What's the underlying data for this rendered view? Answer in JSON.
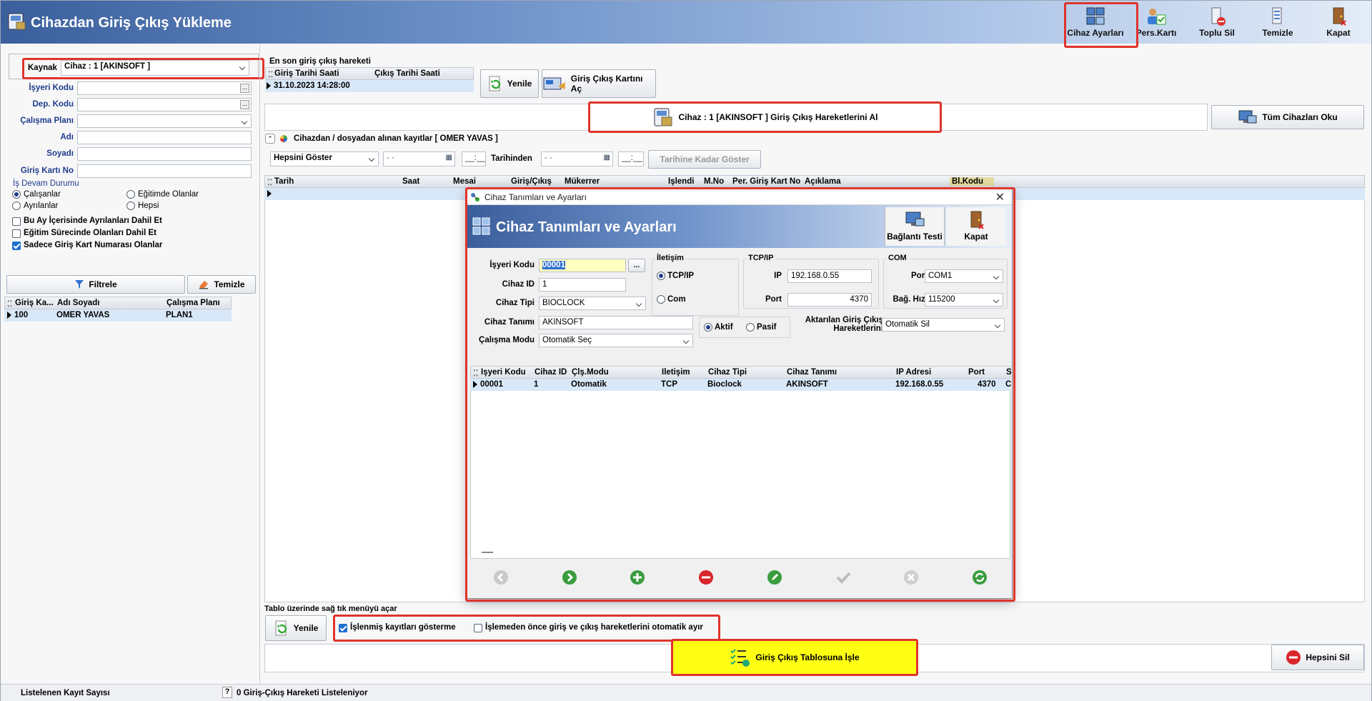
{
  "window": {
    "title": "Cihazdan Giriş Çıkış Yükleme"
  },
  "toolbar": {
    "device_settings": "Cihaz Ayarları",
    "pers_card": "Pers.Kartı",
    "bulk_delete": "Toplu Sil",
    "clear": "Temizle",
    "close": "Kapat"
  },
  "filters": {
    "source_label": "Kaynak",
    "source_value": "Cihaz : 1 [AKINSOFT ]",
    "workplace_label": "İşyeri Kodu",
    "dept_label": "Dep. Kodu",
    "plan_label": "Çalışma Planı",
    "name_label": "Adı",
    "surname_label": "Soyadı",
    "card_label": "Giriş Kartı No",
    "status_group": "İş Devam Durumu",
    "opt_working": "Çalışanlar",
    "opt_training": "Eğitimde Olanlar",
    "opt_left": "Ayrılanlar",
    "opt_all": "Hepsi",
    "chk_month": "Bu Ay İçerisinde Ayrılanları Dahil Et",
    "chk_training": "Eğitim Sürecinde Olanları Dahil Et",
    "chk_only_card": "Sadece Giriş Kart Numarası Olanlar",
    "filter_btn": "Filtrele",
    "clear_btn": "Temizle"
  },
  "people": {
    "headers": [
      "Giriş Ka...",
      "Adı Soyadı",
      "Çalışma Planı"
    ],
    "rows": [
      {
        "card": "100",
        "name": "OMER YAVAS",
        "plan": "PLAN1"
      }
    ]
  },
  "last": {
    "title": "En son giriş çıkış hareketi",
    "h_in": "Giriş Tarihi Saati",
    "h_out": "Çıkış Tarihi Saati",
    "in_value": "31.10.2023 14:28:00",
    "refresh": "Yenile",
    "open_card": "Giriş Çıkış Kartını Aç"
  },
  "fetch": {
    "get_btn": "Cihaz : 1 [AKINSOFT ] Giriş Çıkış Hareketlerini Al",
    "read_all": "Tüm Cihazları Oku"
  },
  "records": {
    "caption": "Cihazdan / dosyadan alınan kayıtlar [ OMER YAVAS ]",
    "show": "Hepsini Göster",
    "date_ph": "- -",
    "time_ph": "__:__",
    "from": "Tarihinden",
    "until_btn": "Tarihine Kadar Göster",
    "headers": [
      "Tarih",
      "Saat",
      "Mesai",
      "Giriş/Çıkış",
      "Mükerrer",
      "İşlendi",
      "M.No",
      "Per. Giriş Kart No",
      "Açıklama",
      "Bl.Kodu"
    ]
  },
  "bottom": {
    "hint": "Tablo üzerinde sağ tık menüyü açar",
    "refresh": "Yenile",
    "chk_processed": "İşlenmiş kayıtları gösterme",
    "chk_split": "İşlemeden önce giriş ve çıkış hareketlerini  otomatik ayır",
    "process": "Giriş Çıkış Tablosuna İşle",
    "delete_all": "Hepsini Sil"
  },
  "status": {
    "count_label": "Listelenen Kayıt Sayısı",
    "help": "?",
    "message": "0 Giriş-Çıkış Hareketi Listeleniyor"
  },
  "dialog": {
    "window_title": "Cihaz Tanımları ve Ayarları",
    "header": "Cihaz Tanımları ve Ayarları",
    "test": "Bağlantı Testi",
    "close": "Kapat",
    "l_workplace": "İşyeri Kodu",
    "v_workplace": "00001",
    "l_device_id": "Cihaz ID",
    "v_device_id": "1",
    "l_device_type": "Cihaz Tipi",
    "v_device_type": "BIOCLOCK",
    "l_device_def": "Cihaz Tanımı",
    "v_device_def": "AKINSOFT",
    "l_mode": "Çalışma Modu",
    "v_mode": "Otomatik Seç",
    "g_comm": "İletişim",
    "o_tcp": "TCP/IP",
    "o_com": "Com",
    "g_tcp": "TCP/IP",
    "l_ip": "IP",
    "v_ip": "192.168.0.55",
    "l_port": "Port",
    "v_port": "4370",
    "g_com": "COM",
    "l_com_port": "Port",
    "v_com_port": "COM1",
    "l_baud": "Bağ. Hızı",
    "v_baud": "115200",
    "o_active": "Aktif",
    "o_passive": "Pasif",
    "l_transfer": "Aktarılan Giriş Çıkış Hareketlerini",
    "v_transfer": "Otomatik Sil",
    "headers": [
      "İşyeri Kodu",
      "Cihaz ID",
      "Çlş.Modu",
      "İletişim",
      "Cihaz Tipi",
      "Cihaz Tanımı",
      "IP Adresi",
      "Port",
      "S"
    ],
    "row": [
      "00001",
      "1",
      "Otomatik",
      "TCP",
      "Bioclock",
      "AKINSOFT",
      "192.168.0.55",
      "4370",
      "C"
    ]
  }
}
